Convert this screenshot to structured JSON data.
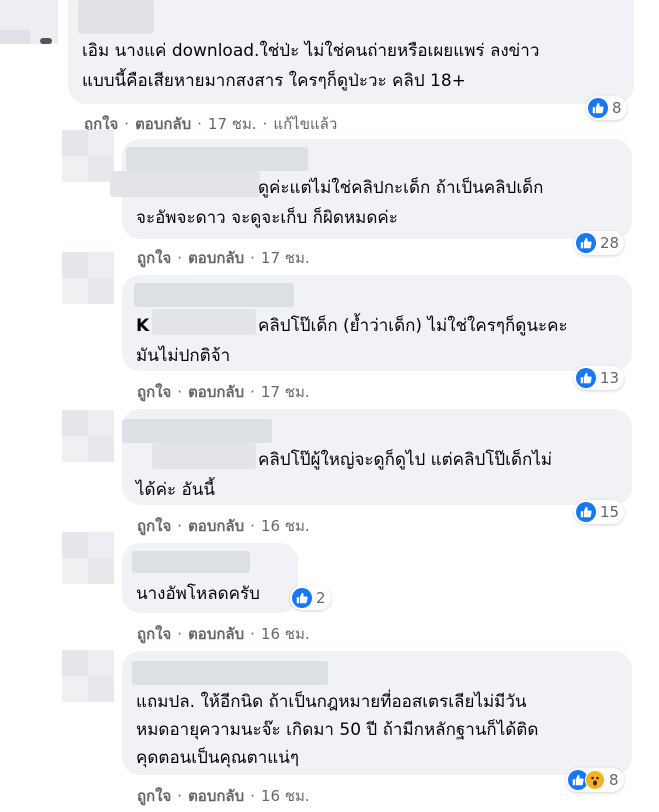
{
  "comments": [
    {
      "author": "",
      "text_lines": [
        "เอิม นางแค่ download.ใช่ป่ะ ไม่ใช่คนถ่ายหรือเผยแพร่ ลงข่าว",
        "แบบนี้คือเสียหายมากสงสาร ใครๆก็ดูป่ะวะ คลิป 18+"
      ],
      "like_label": "ถูกใจ",
      "reply_label": "ตอบกลับ",
      "time": "17 ชม.",
      "edited": "แก้ไขแล้ว",
      "reaction_count": "8",
      "reaction_icons": [
        "like-icon"
      ]
    },
    {
      "author": "",
      "text_lines": [
        "ดูค่ะแต่ไม่ใช่คลิปกะเด็ก ถ้าเป็นคลิปเด็ก",
        "จะอัพจะดาว จะดูจะเก็บ ก็ผิดหมดค่ะ"
      ],
      "like_label": "ถูกใจ",
      "reply_label": "ตอบกลับ",
      "time": "17 ชม.",
      "reaction_count": "28",
      "reaction_icons": [
        "like-icon"
      ]
    },
    {
      "author": "K",
      "text_lines": [
        "คลิปโป๊เด็ก (ย้ำว่าเด็ก) ไม่ใช่ใครๆก็ดูนะคะ",
        "มันไม่ปกติจ้า"
      ],
      "like_label": "ถูกใจ",
      "reply_label": "ตอบกลับ",
      "time": "17 ชม.",
      "reaction_count": "13",
      "reaction_icons": [
        "like-icon"
      ]
    },
    {
      "author": "",
      "text_lines": [
        "คลิปโป๊ผู้ใหญ่จะดูก็ดูไป แต่คลิปโป๊เด็กไม่",
        "ได้ค่ะ อันนี้"
      ],
      "like_label": "ถูกใจ",
      "reply_label": "ตอบกลับ",
      "time": "16 ชม.",
      "reaction_count": "15",
      "reaction_icons": [
        "like-icon"
      ]
    },
    {
      "author": "",
      "text_lines": [
        "นางอัพโหลดครับ"
      ],
      "like_label": "ถูกใจ",
      "reply_label": "ตอบกลับ",
      "time": "16 ชม.",
      "reaction_count": "2",
      "reaction_icons": [
        "like-icon"
      ]
    },
    {
      "author": "",
      "text_lines": [
        "แถมปล. ให้อีกนิด ถ้าเป็นกฎหมายที่ออสเตรเลียไม่มีวัน",
        "หมดอายุความนะจ๊ะ เกิดมา 50 ปี ถ้ามีกหลักฐานก็ได้ติด",
        "คุดตอนเป็นคุณตาแน่ๆ"
      ],
      "like_label": "ถูกใจ",
      "reply_label": "ตอบกลับ",
      "time": "16 ชม.",
      "reaction_count": "8",
      "reaction_icons": [
        "like-icon",
        "wow-icon"
      ]
    }
  ],
  "colors": {
    "bubble": "#f0f2f5",
    "like_blue": "#1877f2",
    "wow_yellow": "#f7b125",
    "meta_gray": "#65676b"
  }
}
